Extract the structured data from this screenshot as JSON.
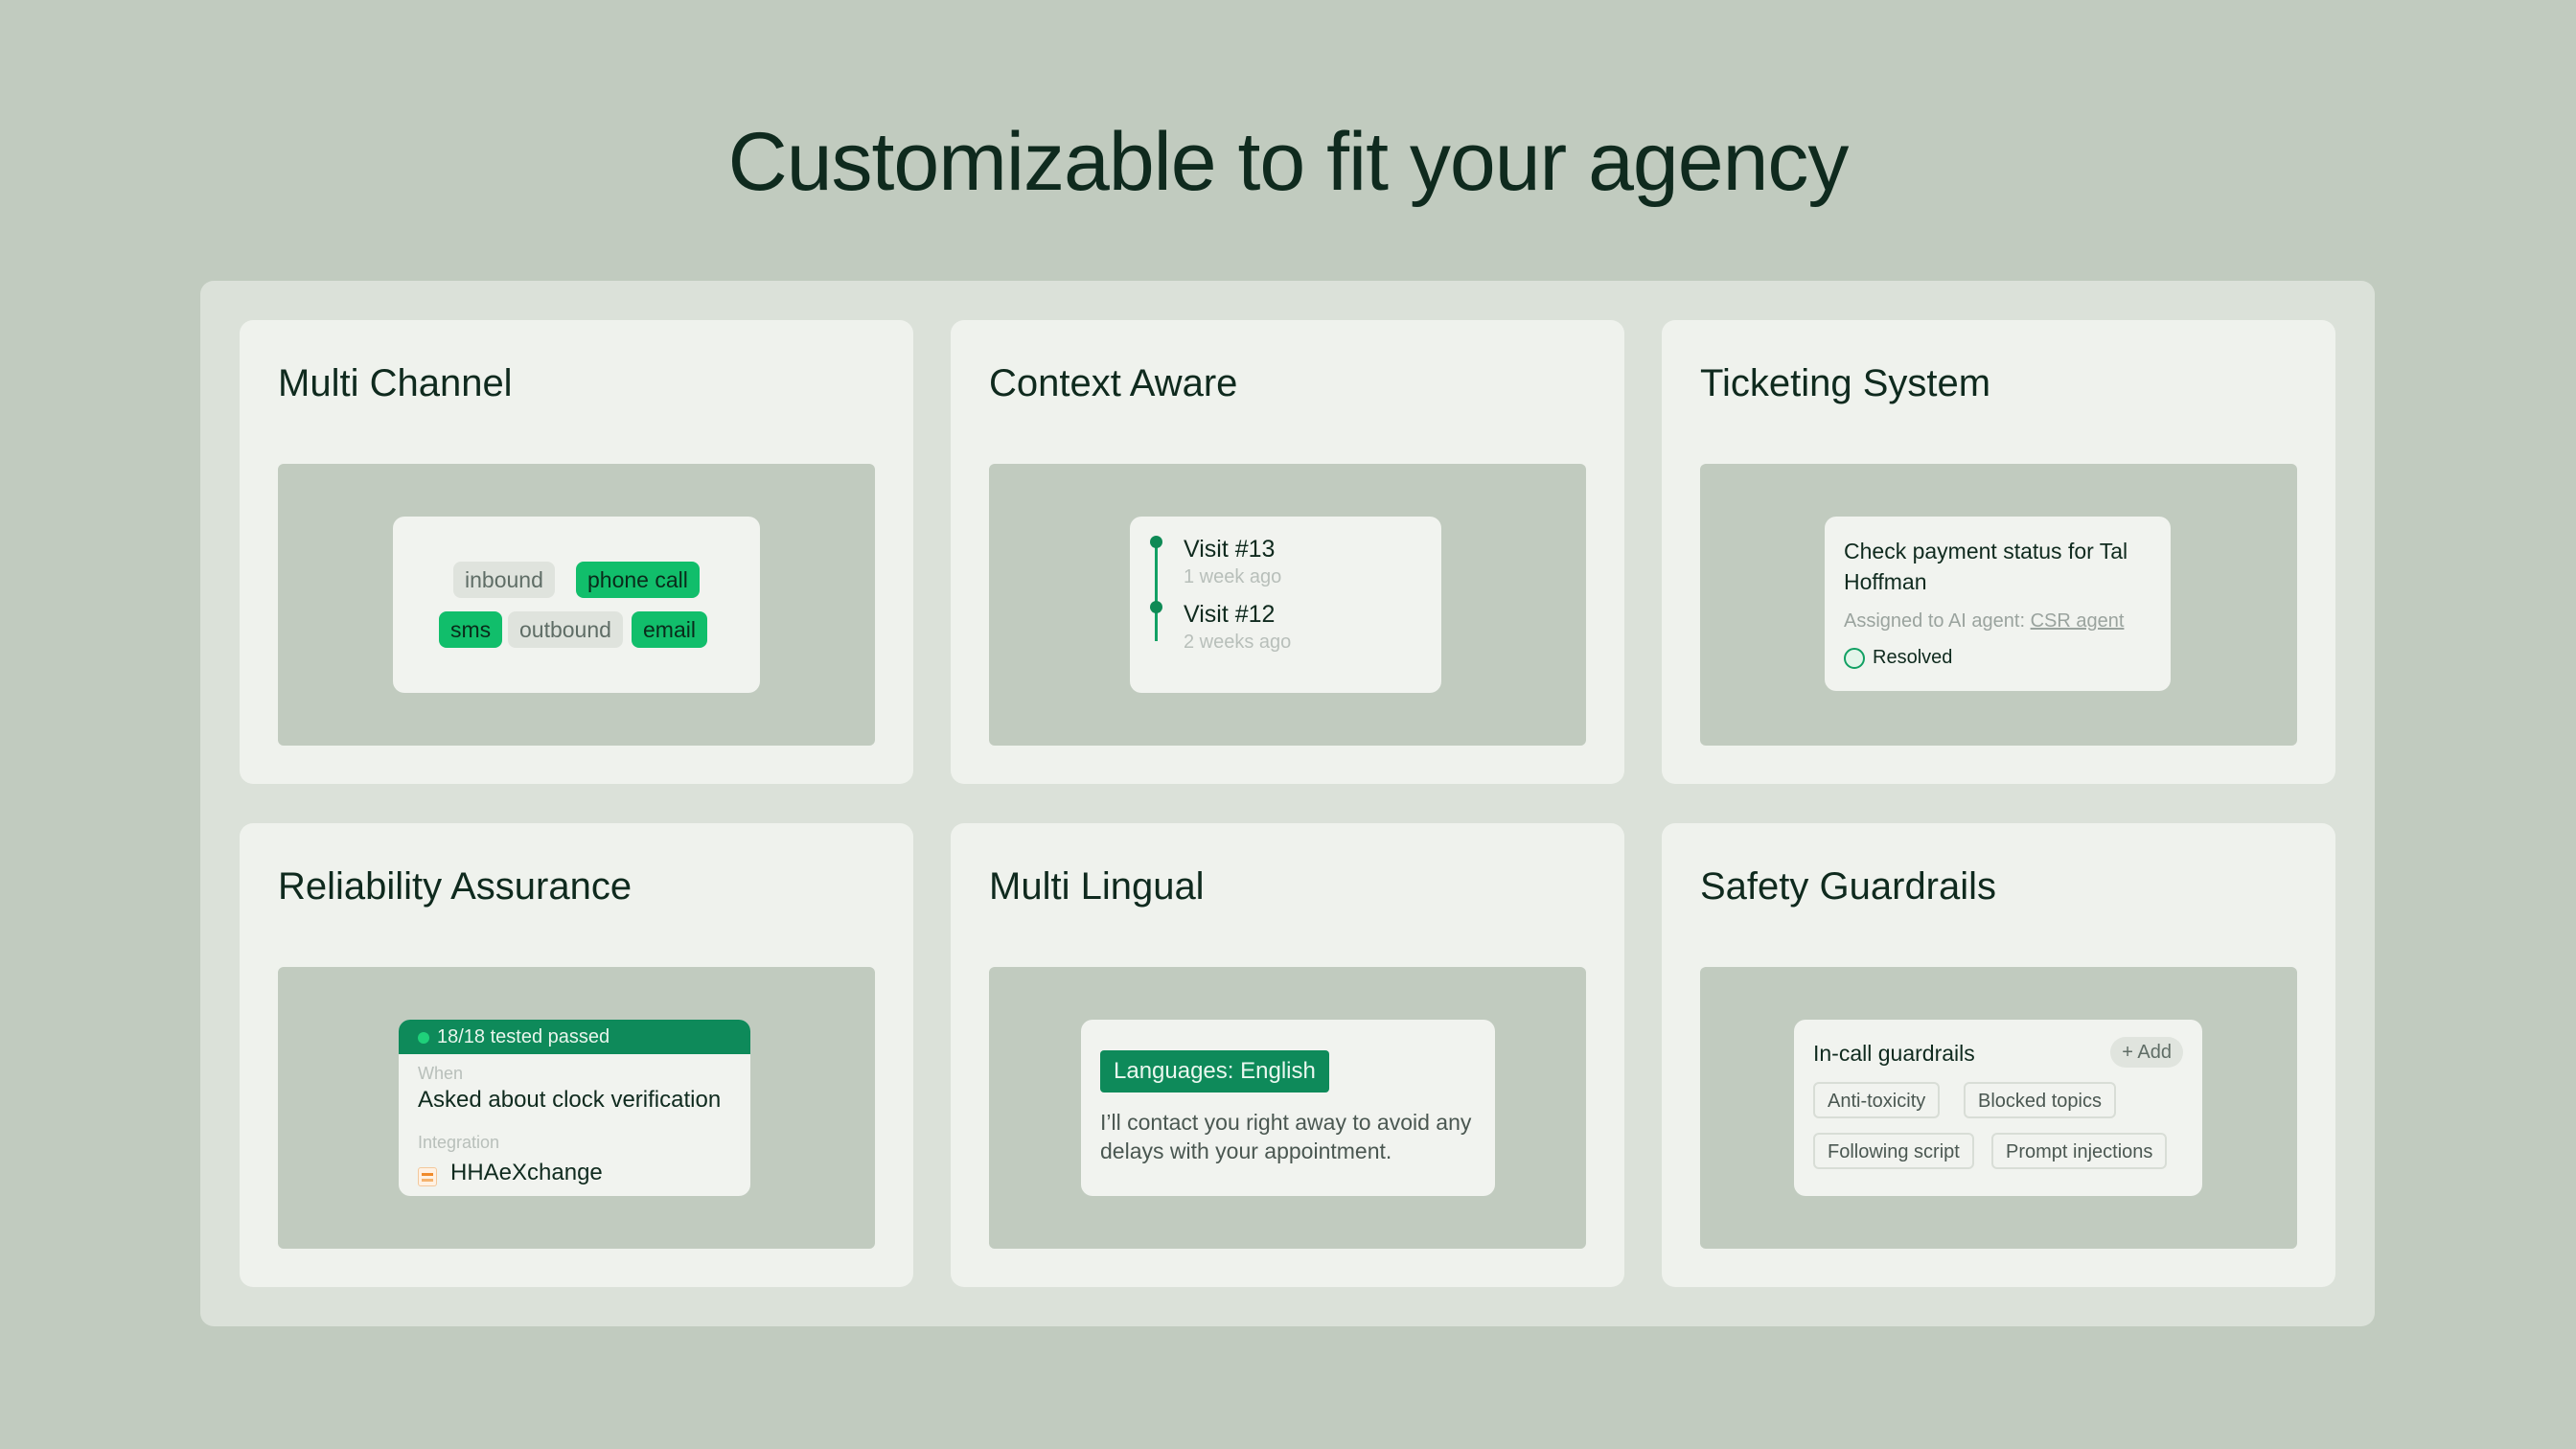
{
  "page": {
    "title": "Customizable to fit your agency"
  },
  "cards": {
    "multi_channel": {
      "title": "Multi Channel",
      "chips": [
        {
          "label": "inbound",
          "active": false
        },
        {
          "label": "phone call",
          "active": true
        },
        {
          "label": "sms",
          "active": true
        },
        {
          "label": "outbound",
          "active": false
        },
        {
          "label": "email",
          "active": true
        }
      ]
    },
    "context_aware": {
      "title": "Context Aware",
      "visits": [
        {
          "label": "Visit #13",
          "time": "1 week ago"
        },
        {
          "label": "Visit #12",
          "time": "2 weeks ago"
        }
      ]
    },
    "ticketing": {
      "title": "Ticketing System",
      "ticket_title": "Check payment status for Tal Hoffman",
      "assigned_prefix": "Assigned to AI agent:",
      "assigned_agent": "CSR agent",
      "status": "Resolved"
    },
    "reliability": {
      "title": "Reliability Assurance",
      "tests_status": "18/18 tested passed",
      "when_label": "When",
      "when_value": "Asked about clock verification",
      "integration_label": "Integration",
      "integration_value": "HHAeXchange"
    },
    "multi_lingual": {
      "title": "Multi Lingual",
      "language_tag": "Languages: English",
      "sample_text": "I’ll contact you right away to avoid any delays with your appointment."
    },
    "safety": {
      "title": "Safety Guardrails",
      "section_title": "In-call guardrails",
      "add_label": "+ Add",
      "guardrails": [
        "Anti-toxicity",
        "Blocked topics",
        "Following script",
        "Prompt injections"
      ]
    }
  },
  "colors": {
    "background": "#c1cbbf",
    "panel": "#dbe1d9",
    "card": "#eff2ed",
    "accent": "#11be6b",
    "accent_dark": "#0e8a5a",
    "text": "#0f2a1e"
  }
}
